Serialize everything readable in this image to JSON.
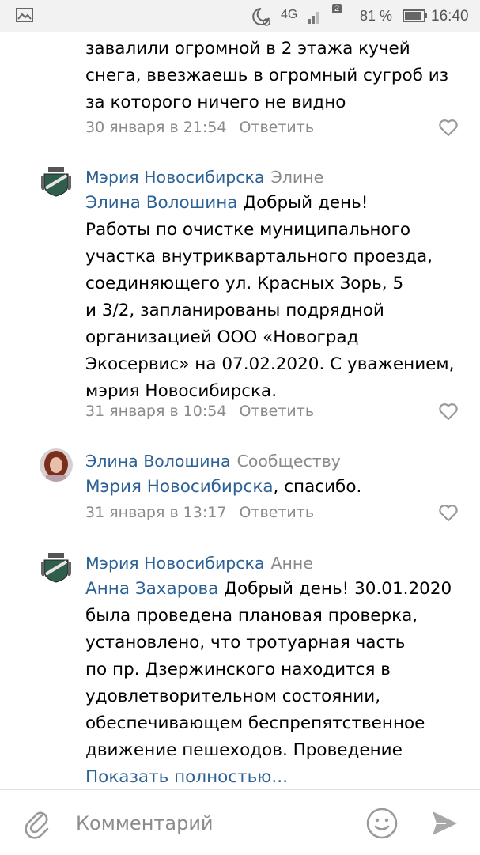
{
  "status_bar": {
    "network": "4G",
    "sim_badge": "2",
    "battery": "81 %",
    "time": "16:40"
  },
  "comments": [
    {
      "lines": [
        "завалили огромной в 2 этажа кучей",
        "снега, ввезжаешь в огромный сугроб из",
        "за которого ничего не видно"
      ],
      "date": "30 января в 21:54",
      "reply": "Ответить"
    },
    {
      "author": "Мэрия Новосибирска",
      "to": "Элине",
      "mention": "Элина Волошина",
      "lines": [
        " Добрый день!",
        "Работы по очистке муниципального",
        "участка внутриквартального проезда,",
        "соединяющего ул. Красных Зорь, 5",
        "и 3/2, запланированы подрядной",
        "организацией ООО «Новоград",
        "Экосервис» на 07.02.2020. С уважением,",
        "мэрия Новосибирска."
      ],
      "date": "31 января в 10:54",
      "reply": "Ответить"
    },
    {
      "author": "Элина Волошина",
      "to": "Сообществу",
      "mention": "Мэрия Новосибирска",
      "lines": [
        ", спасибо."
      ],
      "date": "31 января в 13:17",
      "reply": "Ответить"
    },
    {
      "author": "Мэрия Новосибирска",
      "to": "Анне",
      "mention": "Анна Захарова",
      "lines": [
        " Добрый день! 30.01.2020",
        "была проведена плановая проверка,",
        "установлено, что тротуарная часть",
        "по пр. Дзержинского находится в",
        "удовлетворительном состоянии,",
        "обеспечивающем беспрепятственное",
        "движение пешеходов. Проведение"
      ],
      "show_more": "Показать полностью..."
    }
  ],
  "composer": {
    "placeholder": "Комментарий"
  },
  "colors": {
    "link": "#2d6296",
    "meta": "#8a8a8a",
    "status_bar_bg": "#f2f2f2"
  }
}
